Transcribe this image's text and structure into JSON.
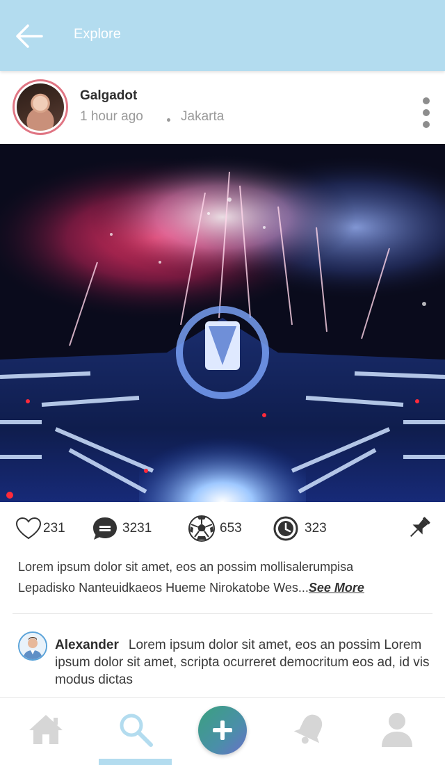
{
  "header": {
    "title": "Explore",
    "background": "#b3dcef"
  },
  "post": {
    "username": "Galgadot",
    "time": "1 hour ago",
    "location": "Jakarta",
    "avatar_border_color": "#e07583",
    "image_description_icon": "fireworks-stage-photo",
    "actions": {
      "likes": "231",
      "messages": "3231",
      "balls": "653",
      "views": "323"
    },
    "caption_line1": "Lorem ipsum dolor sit amet, eos an possim mollisalerumpisa",
    "caption_line2": "Lepadisko Nanteuidkaeos Hueme Nirokatobe Wes...",
    "see_more": "See More"
  },
  "comment": {
    "name": "Alexander",
    "text": "Lorem ipsum dolor sit amet, eos an possim Lorem ipsum dolor sit amet, scripta ocurreret democritum eos ad, id vis modus dictas"
  },
  "bottom_nav": {
    "items": [
      "home-icon",
      "search-icon",
      "add-icon",
      "bell-icon",
      "user-icon"
    ],
    "active": "search-icon",
    "active_color": "#b3dcef",
    "inactive_color": "#d6d6d6"
  }
}
